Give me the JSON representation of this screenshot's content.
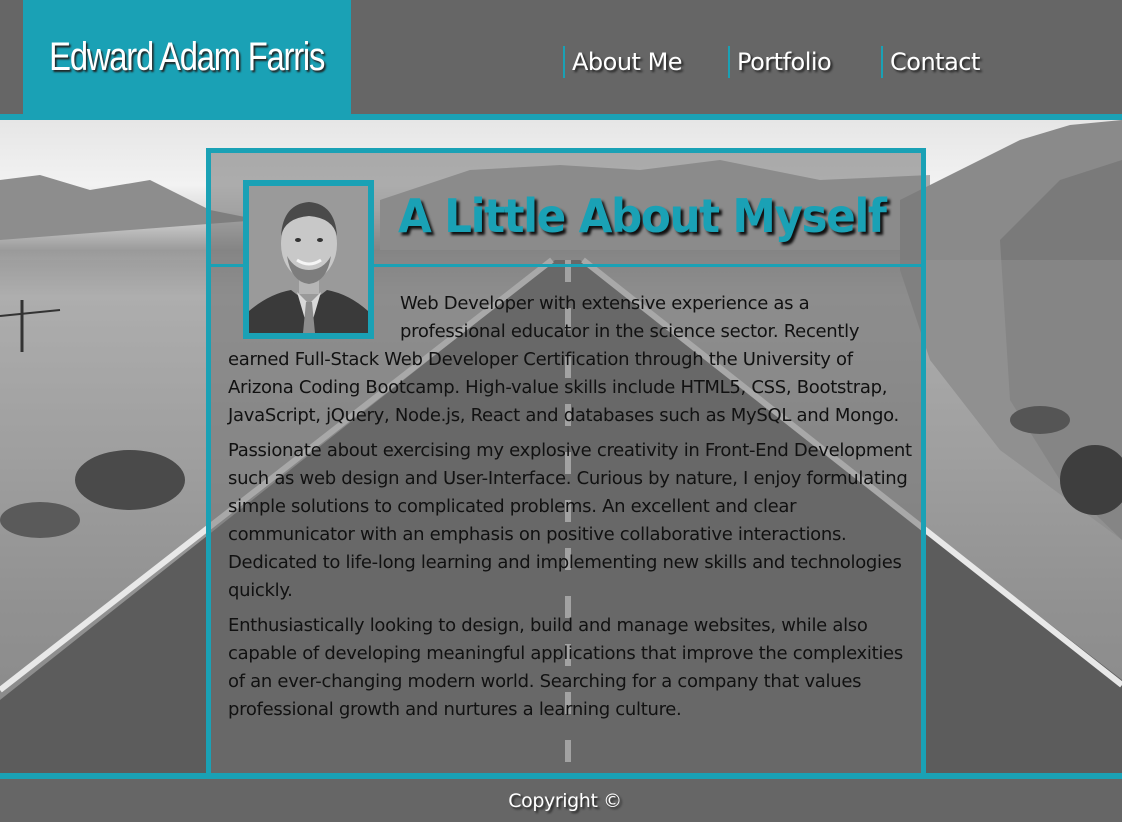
{
  "header": {
    "brand_name": "Edward Adam Farris",
    "nav": [
      {
        "label": "About Me"
      },
      {
        "label": "Portfolio"
      },
      {
        "label": "Contact"
      }
    ]
  },
  "about": {
    "heading": "A Little About Myself",
    "paragraphs": [
      "Web Developer with extensive experience as a professional educator in the science sector. Recently earned Full-Stack Web Developer Certification through the University of Arizona Coding Bootcamp. High-value skills include HTML5, CSS, Bootstrap, JavaScript, jQuery, Node.js, React and databases such as MySQL and Mongo.",
      "Passionate about exercising my explosive creativity in Front-End Development such as web design and User-Interface. Curious by nature, I enjoy formulating simple solutions to complicated problems. An excellent and clear communicator with an emphasis on positive collaborative interactions. Dedicated to life-long learning and implementing new skills and technologies quickly.",
      "Enthusiastically looking to design, build and manage websites, while also capable of developing meaningful applications that improve the complexities of an ever-changing modern world. Searching for a company that values professional growth and nurtures a learning culture."
    ]
  },
  "footer": {
    "copyright": "Copyright ©"
  },
  "colors": {
    "accent": "#1aa1b5",
    "bar": "#666666"
  }
}
